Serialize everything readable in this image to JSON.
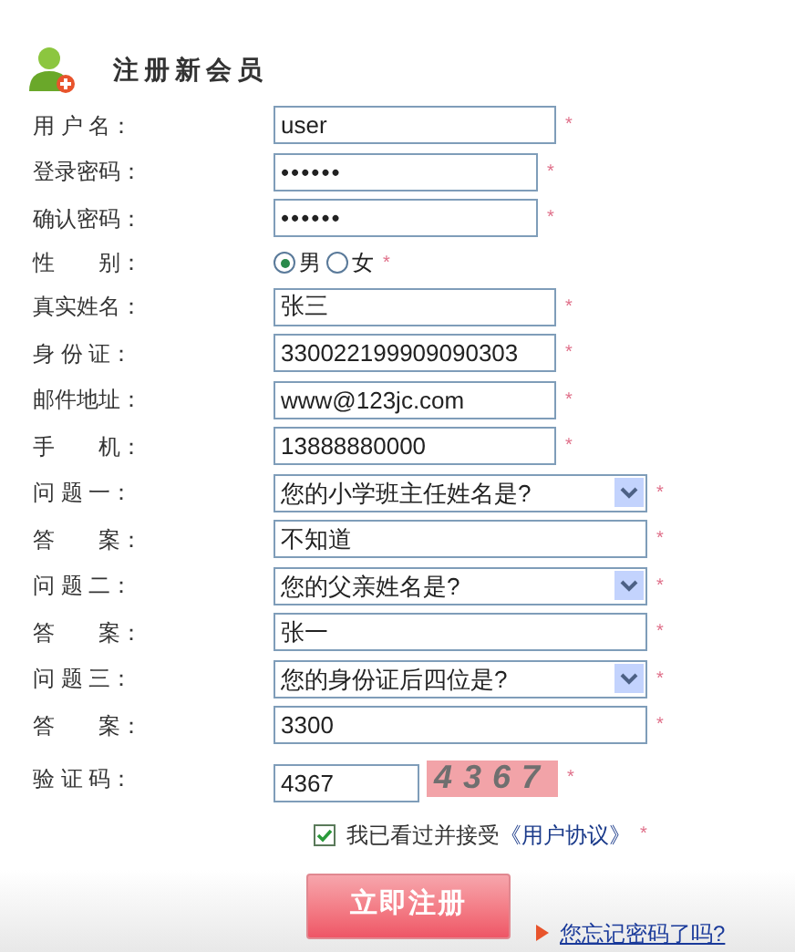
{
  "title": "注册新会员",
  "fields": [
    {
      "kind": "text",
      "label": "用 户 名：",
      "value": "user",
      "required": "*"
    },
    {
      "kind": "password",
      "label": "登录密码：",
      "value": "••••••",
      "required": "*"
    },
    {
      "kind": "password",
      "label": "确认密码：",
      "value": "••••••",
      "required": "*"
    },
    {
      "kind": "radio",
      "label": "性　　别：",
      "options": [
        {
          "label": "男",
          "selected": true
        },
        {
          "label": "女",
          "selected": false
        }
      ],
      "required": "*"
    },
    {
      "kind": "text",
      "label": "真实姓名：",
      "value": "张三",
      "required": "*"
    },
    {
      "kind": "text",
      "label": "身 份 证：",
      "value": "330022199909090303",
      "required": "*"
    },
    {
      "kind": "text",
      "label": "邮件地址：",
      "value": "www@123jc.com",
      "required": "*"
    },
    {
      "kind": "text",
      "label": "手　　机：",
      "value": "13888880000",
      "required": "*"
    },
    {
      "kind": "select",
      "label": "问 题 一：",
      "value": "您的小学班主任姓名是?",
      "required": "*"
    },
    {
      "kind": "answer",
      "label": "答　　案：",
      "value": "不知道",
      "required": "*"
    },
    {
      "kind": "select",
      "label": "问 题 二：",
      "value": "您的父亲姓名是?",
      "required": "*"
    },
    {
      "kind": "answer",
      "label": "答　　案：",
      "value": "张一",
      "required": "*"
    },
    {
      "kind": "select",
      "label": "问 题 三：",
      "value": "您的身份证后四位是?",
      "required": "*"
    },
    {
      "kind": "answer",
      "label": "答　　案：",
      "value": "3300",
      "required": "*"
    },
    {
      "kind": "captcha",
      "label": "验 证 码：",
      "value": "4367",
      "code": "4367",
      "required": "*"
    }
  ],
  "agreement": {
    "checked": true,
    "text": "我已看过并接受",
    "link": "《用户协议》",
    "required": "*"
  },
  "submit": "立即注册",
  "forgot_link": "您忘记密码了吗?"
}
